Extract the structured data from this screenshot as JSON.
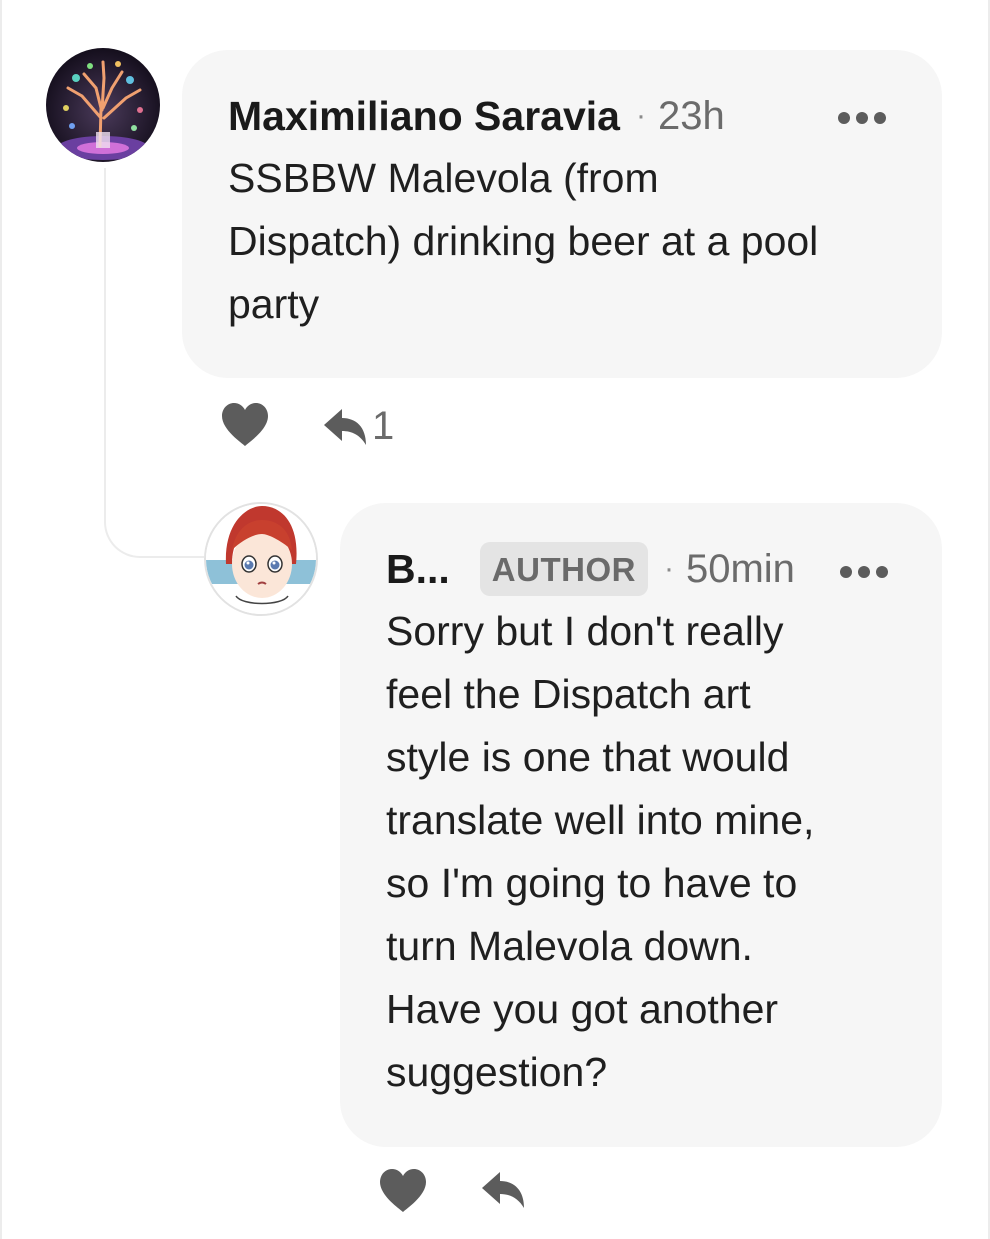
{
  "colors": {
    "bubble_background": "#f6f6f6",
    "icon_gray": "#5c5c5c",
    "badge_background": "#e4e4e4",
    "thread_line": "#ececec"
  },
  "comments": [
    {
      "avatar_icon": "tree-art-avatar",
      "author": "Maximiliano Saravia",
      "separator": "·",
      "time": "23h",
      "more_icon": "more-horizontal-icon",
      "text": "SSBBW Malevola (from\nDispatch) drinking beer at a pool\nparty",
      "like_icon": "heart-icon",
      "reply_icon": "reply-arrow-icon",
      "reply_count": "1"
    },
    {
      "avatar_icon": "anime-girl-avatar",
      "author": "B...",
      "badge": "AUTHOR",
      "separator": "·",
      "time": "50min",
      "more_icon": "more-horizontal-icon",
      "text": "Sorry but I don't really\nfeel the Dispatch art\nstyle is one that would\ntranslate well into mine,\nso I'm going to have to\nturn Malevola down.\nHave you got another\nsuggestion?",
      "like_icon": "heart-icon",
      "reply_icon": "reply-arrow-icon"
    }
  ]
}
